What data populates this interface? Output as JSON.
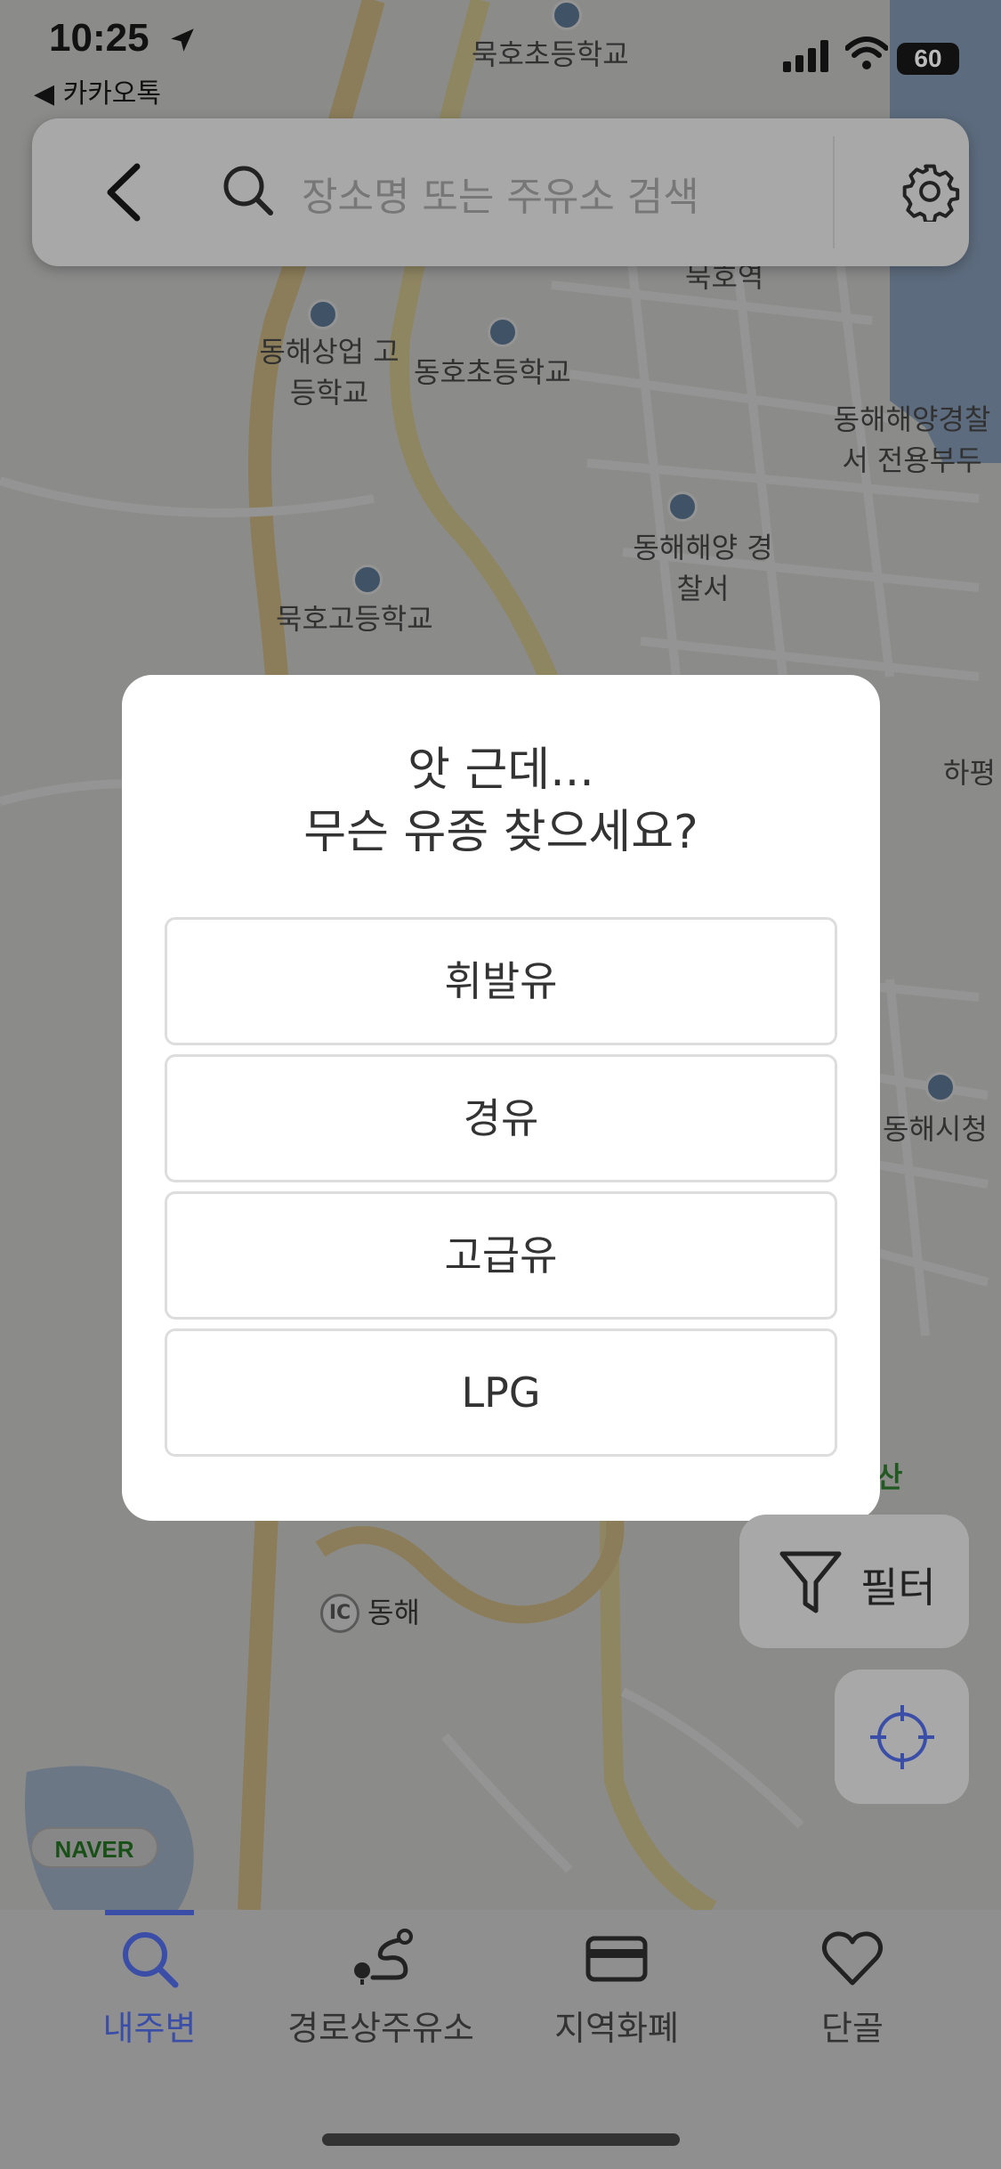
{
  "status_bar": {
    "time": "10:25",
    "back_app": "◀ 카카오톡",
    "battery": "60"
  },
  "map": {
    "labels": [
      "묵호초등학교",
      "동해상업 고등학교",
      "동호초등학교",
      "동해해양경찰서 전용부두",
      "동해해양 경찰서",
      "묵호고등학교",
      "하평",
      "동해시청",
      "산",
      "동해",
      "묵호역"
    ],
    "ic_badge": "IC",
    "road_label": "동해",
    "logo": "NAVER"
  },
  "search": {
    "placeholder": "장소명 또는 주유소 검색",
    "back_icon": "chevron-left-icon",
    "search_icon": "search-icon",
    "settings_icon": "gear-icon"
  },
  "dialog": {
    "title_line1": "앗 근데...",
    "title_line2": "무슨 유종 찾으세요?",
    "options": [
      "휘발유",
      "경유",
      "고급유",
      "LPG"
    ]
  },
  "filter_button": {
    "label": "필터",
    "icon": "funnel-icon"
  },
  "locate_button": {
    "icon": "crosshair-icon"
  },
  "tabs": [
    {
      "label": "내주변",
      "icon": "search-icon",
      "active": true
    },
    {
      "label": "경로상주유소",
      "icon": "route-icon",
      "active": false
    },
    {
      "label": "지역화폐",
      "icon": "card-icon",
      "active": false
    },
    {
      "label": "단골",
      "icon": "heart-icon",
      "active": false
    }
  ],
  "colors": {
    "accent": "#3a4ea8",
    "dim_overlay": "rgba(0,0,0,0.42)",
    "dialog_bg": "#ffffff"
  }
}
